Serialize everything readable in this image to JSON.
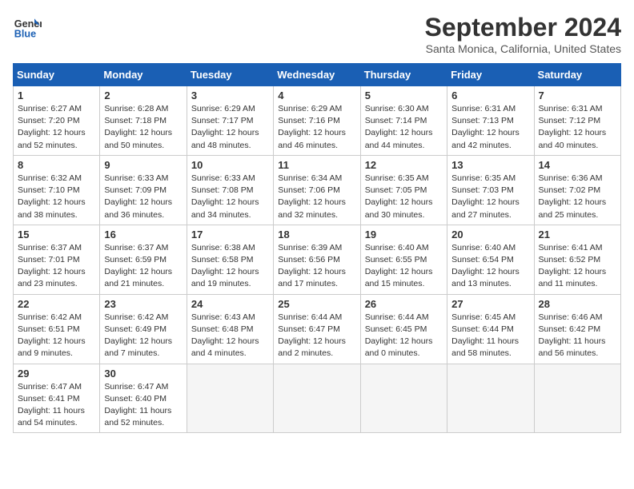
{
  "header": {
    "logo_line1": "General",
    "logo_line2": "Blue",
    "month": "September 2024",
    "location": "Santa Monica, California, United States"
  },
  "weekdays": [
    "Sunday",
    "Monday",
    "Tuesday",
    "Wednesday",
    "Thursday",
    "Friday",
    "Saturday"
  ],
  "weeks": [
    [
      {
        "day": "1",
        "sunrise": "6:27 AM",
        "sunset": "7:20 PM",
        "daylight": "12 hours and 52 minutes."
      },
      {
        "day": "2",
        "sunrise": "6:28 AM",
        "sunset": "7:18 PM",
        "daylight": "12 hours and 50 minutes."
      },
      {
        "day": "3",
        "sunrise": "6:29 AM",
        "sunset": "7:17 PM",
        "daylight": "12 hours and 48 minutes."
      },
      {
        "day": "4",
        "sunrise": "6:29 AM",
        "sunset": "7:16 PM",
        "daylight": "12 hours and 46 minutes."
      },
      {
        "day": "5",
        "sunrise": "6:30 AM",
        "sunset": "7:14 PM",
        "daylight": "12 hours and 44 minutes."
      },
      {
        "day": "6",
        "sunrise": "6:31 AM",
        "sunset": "7:13 PM",
        "daylight": "12 hours and 42 minutes."
      },
      {
        "day": "7",
        "sunrise": "6:31 AM",
        "sunset": "7:12 PM",
        "daylight": "12 hours and 40 minutes."
      }
    ],
    [
      {
        "day": "8",
        "sunrise": "6:32 AM",
        "sunset": "7:10 PM",
        "daylight": "12 hours and 38 minutes."
      },
      {
        "day": "9",
        "sunrise": "6:33 AM",
        "sunset": "7:09 PM",
        "daylight": "12 hours and 36 minutes."
      },
      {
        "day": "10",
        "sunrise": "6:33 AM",
        "sunset": "7:08 PM",
        "daylight": "12 hours and 34 minutes."
      },
      {
        "day": "11",
        "sunrise": "6:34 AM",
        "sunset": "7:06 PM",
        "daylight": "12 hours and 32 minutes."
      },
      {
        "day": "12",
        "sunrise": "6:35 AM",
        "sunset": "7:05 PM",
        "daylight": "12 hours and 30 minutes."
      },
      {
        "day": "13",
        "sunrise": "6:35 AM",
        "sunset": "7:03 PM",
        "daylight": "12 hours and 27 minutes."
      },
      {
        "day": "14",
        "sunrise": "6:36 AM",
        "sunset": "7:02 PM",
        "daylight": "12 hours and 25 minutes."
      }
    ],
    [
      {
        "day": "15",
        "sunrise": "6:37 AM",
        "sunset": "7:01 PM",
        "daylight": "12 hours and 23 minutes."
      },
      {
        "day": "16",
        "sunrise": "6:37 AM",
        "sunset": "6:59 PM",
        "daylight": "12 hours and 21 minutes."
      },
      {
        "day": "17",
        "sunrise": "6:38 AM",
        "sunset": "6:58 PM",
        "daylight": "12 hours and 19 minutes."
      },
      {
        "day": "18",
        "sunrise": "6:39 AM",
        "sunset": "6:56 PM",
        "daylight": "12 hours and 17 minutes."
      },
      {
        "day": "19",
        "sunrise": "6:40 AM",
        "sunset": "6:55 PM",
        "daylight": "12 hours and 15 minutes."
      },
      {
        "day": "20",
        "sunrise": "6:40 AM",
        "sunset": "6:54 PM",
        "daylight": "12 hours and 13 minutes."
      },
      {
        "day": "21",
        "sunrise": "6:41 AM",
        "sunset": "6:52 PM",
        "daylight": "12 hours and 11 minutes."
      }
    ],
    [
      {
        "day": "22",
        "sunrise": "6:42 AM",
        "sunset": "6:51 PM",
        "daylight": "12 hours and 9 minutes."
      },
      {
        "day": "23",
        "sunrise": "6:42 AM",
        "sunset": "6:49 PM",
        "daylight": "12 hours and 7 minutes."
      },
      {
        "day": "24",
        "sunrise": "6:43 AM",
        "sunset": "6:48 PM",
        "daylight": "12 hours and 4 minutes."
      },
      {
        "day": "25",
        "sunrise": "6:44 AM",
        "sunset": "6:47 PM",
        "daylight": "12 hours and 2 minutes."
      },
      {
        "day": "26",
        "sunrise": "6:44 AM",
        "sunset": "6:45 PM",
        "daylight": "12 hours and 0 minutes."
      },
      {
        "day": "27",
        "sunrise": "6:45 AM",
        "sunset": "6:44 PM",
        "daylight": "11 hours and 58 minutes."
      },
      {
        "day": "28",
        "sunrise": "6:46 AM",
        "sunset": "6:42 PM",
        "daylight": "11 hours and 56 minutes."
      }
    ],
    [
      {
        "day": "29",
        "sunrise": "6:47 AM",
        "sunset": "6:41 PM",
        "daylight": "11 hours and 54 minutes."
      },
      {
        "day": "30",
        "sunrise": "6:47 AM",
        "sunset": "6:40 PM",
        "daylight": "11 hours and 52 minutes."
      },
      null,
      null,
      null,
      null,
      null
    ]
  ]
}
